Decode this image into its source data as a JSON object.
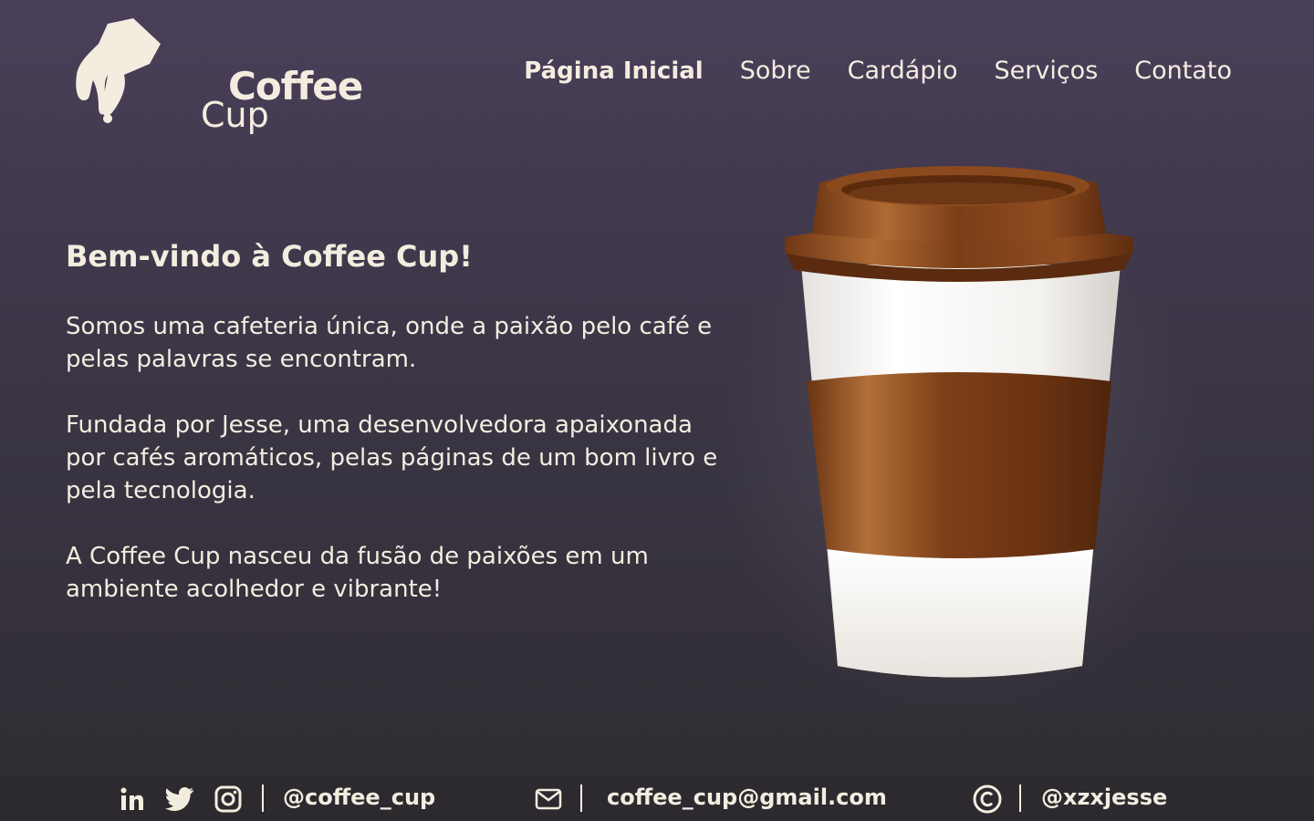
{
  "brand": {
    "line1": "Coffee",
    "line2": "Cup"
  },
  "nav": {
    "items": [
      {
        "label": "Página Inicial",
        "active": true
      },
      {
        "label": "Sobre",
        "active": false
      },
      {
        "label": "Cardápio",
        "active": false
      },
      {
        "label": "Serviços",
        "active": false
      },
      {
        "label": "Contato",
        "active": false
      }
    ]
  },
  "hero": {
    "title": "Bem-vindo à Coffee Cup!",
    "paragraphs": [
      "Somos uma cafeteria única, onde a paixão pelo café e pelas palavras se encontram.",
      "Fundada por Jesse, uma desenvolvedora apaixonada por cafés aromáticos, pelas páginas de um bom livro e pela tecnologia.",
      "A Coffee Cup nasceu da fusão de paixões em um ambiente acolhedor e vibrante!"
    ]
  },
  "footer": {
    "social_icons": [
      "linkedin-icon",
      "twitter-icon",
      "instagram-icon"
    ],
    "social_handle": "@coffee_cup",
    "email_icon": "mail-icon",
    "email": "coffee_cup@gmail.com",
    "copyright_icon": "copyright-icon",
    "author": "@xzxjesse"
  },
  "colors": {
    "text": "#f3ede0",
    "background_top": "#4a3f59",
    "background_bottom": "#302d33",
    "footer_bg": "#2c2a2f",
    "cup_brown": "#8a4a1e"
  }
}
